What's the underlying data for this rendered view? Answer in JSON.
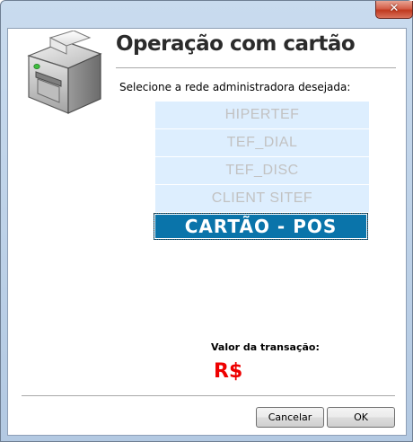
{
  "window": {
    "close_glyph": "✕"
  },
  "header": {
    "icon": "printer-icon",
    "title": "Operação com cartão"
  },
  "prompt": "Selecione a rede administradora desejada:",
  "networks": [
    {
      "label": "HIPERTEF",
      "selected": false
    },
    {
      "label": "TEF_DIAL",
      "selected": false
    },
    {
      "label": "TEF_DISC",
      "selected": false
    },
    {
      "label": "CLIENT SITEF",
      "selected": false
    },
    {
      "label": "CARTÃO - POS",
      "selected": true
    }
  ],
  "transaction": {
    "label": "Valor da transação:",
    "value": "R$"
  },
  "buttons": {
    "cancel": "Cancelar",
    "ok": "OK"
  },
  "colors": {
    "item_background": "#ddeefe",
    "item_text": "#c2c2c2",
    "selected_background": "#0a74aa",
    "selected_text": "#ffffff",
    "amount_text": "#ee0000"
  }
}
